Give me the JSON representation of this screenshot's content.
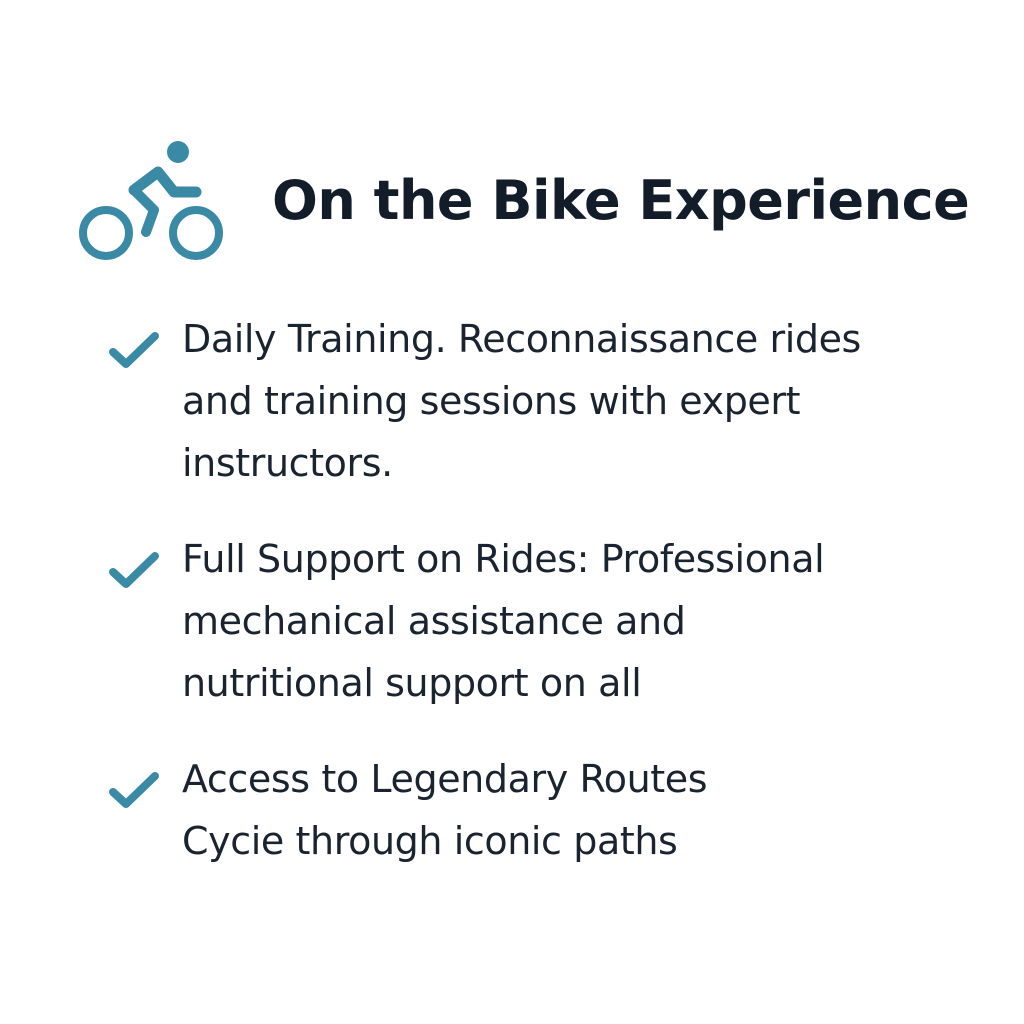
{
  "header": {
    "icon": "bicycle-rider-icon",
    "title": "On the Bike Experience"
  },
  "colors": {
    "accent": "#3a8aa6",
    "text": "#15202b",
    "background": "#ffffff"
  },
  "features": [
    {
      "icon": "check-icon",
      "lines": [
        "Daily Training. Reconnaissance rides",
        "and training sessions with expert",
        "instructors."
      ]
    },
    {
      "icon": "check-icon",
      "lines": [
        "Full Support on Rides: Professional",
        "mechanical assistance and",
        "nutritional support on all"
      ]
    },
    {
      "icon": "check-icon",
      "lines": [
        "Access to Legendary Routes",
        "Cycie through iconic paths"
      ]
    }
  ]
}
